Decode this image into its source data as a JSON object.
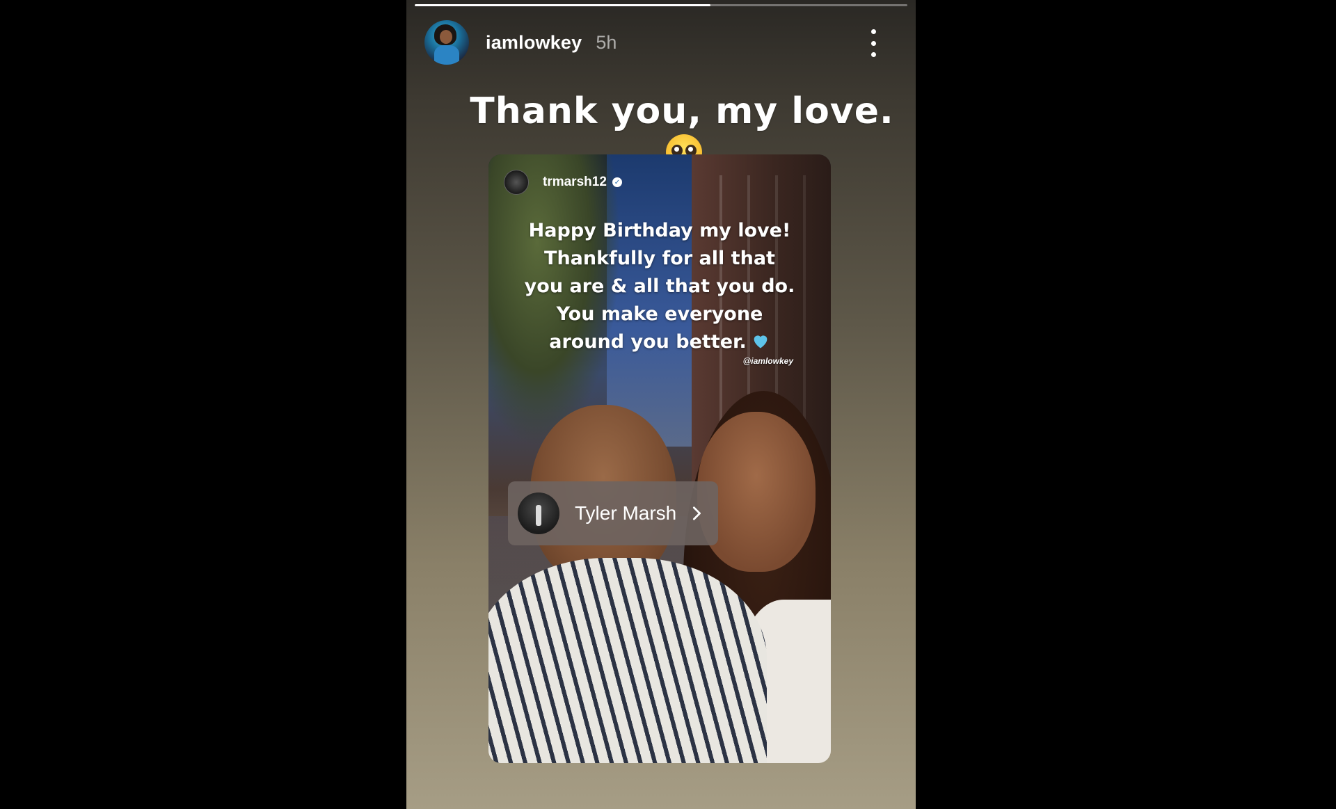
{
  "story": {
    "progress": 0.6,
    "username": "iamlowkey",
    "time": "5h",
    "caption": "Thank you, my love.",
    "caption_emoji": "pleading-face"
  },
  "shared_post": {
    "username": "trmarsh12",
    "verified": true,
    "text": "Happy Birthday my love!\nThankfully for all that\nyou are & all that you do.\nYou make everyone\naround you better.",
    "text_emoji": "blue-heart",
    "mention_tag": "@iamlowkey",
    "mention_sticker": {
      "name": "Tyler Marsh"
    }
  },
  "colors": {
    "background": "#000000",
    "accent_blue_heart": "#5ec4ea"
  }
}
